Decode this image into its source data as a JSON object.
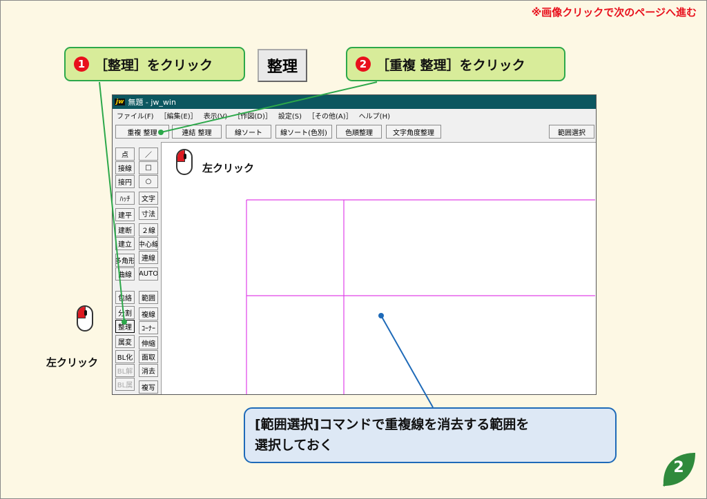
{
  "top_note": "※画像クリックで次のページへ進む",
  "step1": {
    "number": "1",
    "text": "［整理］をクリック"
  },
  "step2": {
    "number": "2",
    "text": "［重複 整理］をクリック"
  },
  "big_button": "整理",
  "app": {
    "logo": "jw",
    "title": "無題 - jw_win",
    "menu": [
      "ファイル(F)",
      "［編集(E)］",
      "表示(V)",
      "［作図(D)］",
      "設定(S)",
      "［その他(A)］",
      "ヘルプ(H)"
    ],
    "toolbar": [
      "重複 整理",
      "連結 整理",
      "線ソート",
      "線ソート(色別)",
      "色順整理",
      "文字角度整理",
      "範囲選択"
    ],
    "left_col1": [
      "点",
      "接線",
      "接円",
      "ﾊｯﾁ",
      "建平",
      "建断",
      "建立",
      "多角形",
      "曲線",
      "包絡",
      "分割",
      "整理",
      "属変",
      "BL化",
      "BL解",
      "BL属"
    ],
    "left_col2": [
      "／",
      "□",
      "○",
      "文字",
      "寸法",
      "２線",
      "中心線",
      "連線",
      "AUTO",
      "範囲",
      "複線",
      "ｺｰﾅｰ",
      "伸縮",
      "面取",
      "消去",
      "複写"
    ]
  },
  "mouse_label_left": "左クリック",
  "mouse_label_top": "左クリック",
  "callout_line1": "[範囲選択]コマンドで重複線を消去する範囲を",
  "callout_line2": "選択しておく",
  "page_number": "2",
  "colors": {
    "green_border": "#2ca84a",
    "green_fill": "#d8ec9a",
    "accent_red": "#e8101c",
    "blue": "#1e6ab8",
    "magenta_lines": "#e040e8",
    "titlebar": "#0c5760"
  }
}
